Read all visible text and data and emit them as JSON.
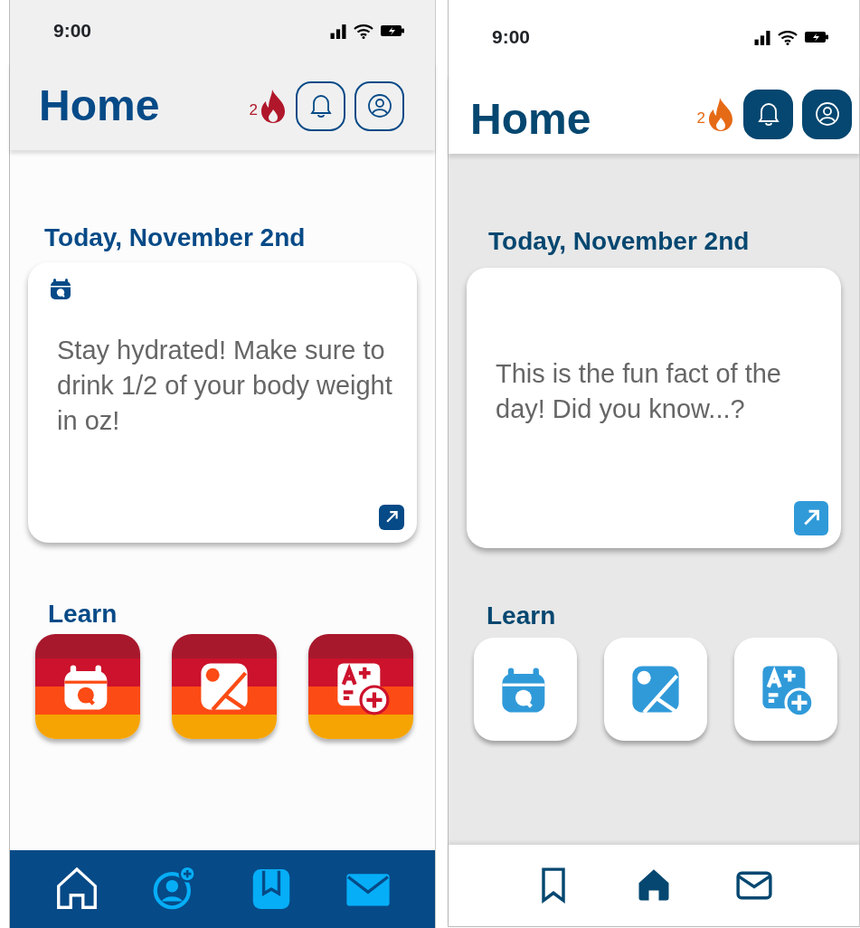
{
  "screens": [
    {
      "kind": "striped",
      "status_bar": {
        "time": "9:00"
      },
      "header": {
        "title": "Home",
        "streak": "2"
      },
      "date_heading": "Today, November 2nd",
      "fact_card": {
        "text": "Stay hydrated! Make sure to drink 1/2 of your body weight in oz!"
      },
      "learn": {
        "title": "Learn",
        "tiles": [
          {
            "kind": "calendar"
          },
          {
            "kind": "image"
          },
          {
            "kind": "grade"
          }
        ]
      },
      "nav": [
        {
          "kind": "home",
          "selected": true
        },
        {
          "kind": "profile",
          "selected": false
        },
        {
          "kind": "book",
          "selected": false
        },
        {
          "kind": "mail",
          "selected": false
        }
      ]
    },
    {
      "kind": "plain",
      "status_bar": {
        "time": "9:00"
      },
      "header": {
        "title": "Home",
        "streak": "2"
      },
      "date_heading": "Today, November 2nd",
      "fact_card": {
        "text": "This is the fun fact of the day! Did you know...?"
      },
      "learn": {
        "title": "Learn",
        "tiles": [
          {
            "kind": "calendar"
          },
          {
            "kind": "image"
          },
          {
            "kind": "grade"
          }
        ]
      },
      "nav": [
        {
          "kind": "bookmark",
          "selected": false
        },
        {
          "kind": "home",
          "selected": true
        },
        {
          "kind": "mail",
          "selected": false
        }
      ]
    }
  ]
}
